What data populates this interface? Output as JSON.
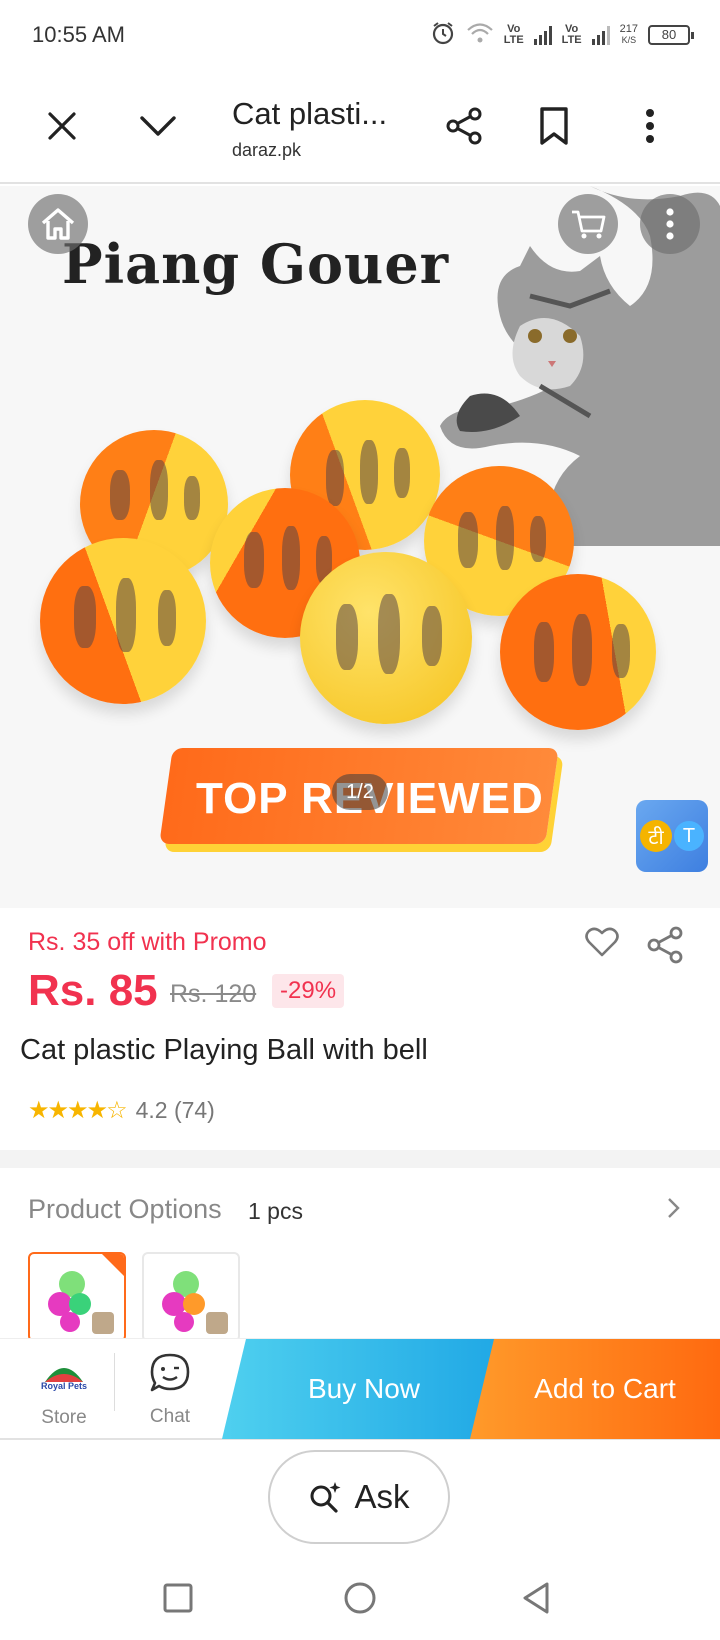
{
  "status_bar": {
    "time": "10:55 AM",
    "lte1": "Vo\nLTE",
    "lte2": "Vo\nLTE",
    "speed_value": "217",
    "speed_unit": "K/S",
    "battery": "80"
  },
  "browser": {
    "title": "Cat plasti...",
    "url": "daraz.pk",
    "icons": [
      "close-icon",
      "chevron-down-icon",
      "share-icon",
      "bookmark-icon",
      "more-vertical-icon"
    ]
  },
  "gallery": {
    "brand_text": "Piang Gouer",
    "ribbon_text": "TOP REVIEWED",
    "pager": "1/2",
    "translate_label": "टी",
    "translate_sub": "T"
  },
  "product": {
    "promo": "Rs. 35 off with Promo",
    "price": "Rs. 85",
    "old_price": "Rs. 120",
    "discount": "-29%",
    "title": "Cat plastic Playing Ball with bell",
    "rating_value": 4.2,
    "rating_text": "4.2 (74)"
  },
  "options": {
    "label": "Product Options",
    "value": "1 pcs"
  },
  "actions": {
    "store_label": "Store",
    "store_logo_text": "Royal Pets",
    "chat_label": "Chat",
    "buy_now": "Buy Now",
    "add_to_cart": "Add to Cart"
  },
  "ask": {
    "label": "Ask"
  },
  "colors": {
    "accent_red": "#f1324f",
    "buy_blue": "#1fa7e5",
    "cart_orange": "#ff6a10"
  }
}
